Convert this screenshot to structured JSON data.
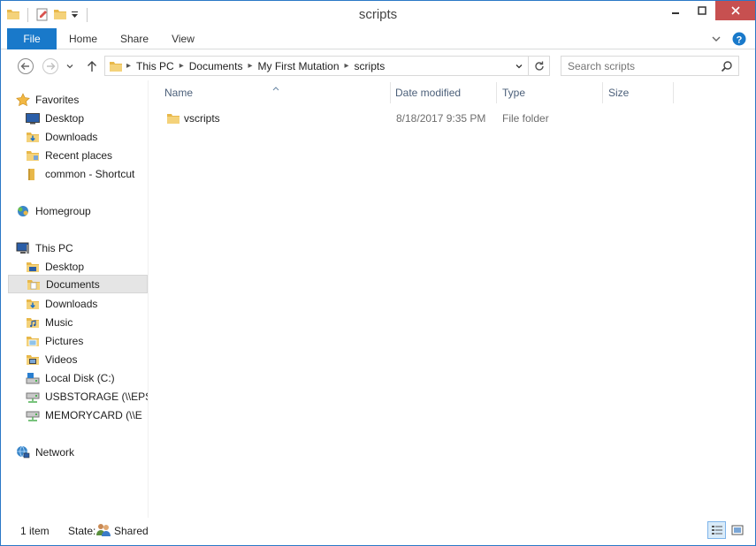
{
  "window": {
    "title": "scripts"
  },
  "ribbon": {
    "tabs": [
      "File",
      "Home",
      "Share",
      "View"
    ]
  },
  "address": {
    "crumbs": [
      "This PC",
      "Documents",
      "My First Mutation",
      "scripts"
    ]
  },
  "search": {
    "placeholder": "Search scripts"
  },
  "nav": {
    "favorites": {
      "label": "Favorites",
      "items": [
        "Desktop",
        "Downloads",
        "Recent places",
        "common - Shortcut"
      ]
    },
    "homegroup": {
      "label": "Homegroup"
    },
    "thispc": {
      "label": "This PC",
      "items": [
        "Desktop",
        "Documents",
        "Downloads",
        "Music",
        "Pictures",
        "Videos",
        "Local Disk (C:)",
        "USBSTORAGE (\\\\EPS",
        "MEMORYCARD (\\\\E"
      ]
    },
    "network": {
      "label": "Network"
    },
    "selected": "Documents"
  },
  "columns": {
    "name": "Name",
    "date": "Date modified",
    "type": "Type",
    "size": "Size"
  },
  "files": [
    {
      "name": "vscripts",
      "date": "8/18/2017 9:35 PM",
      "type": "File folder",
      "size": ""
    }
  ],
  "status": {
    "count": "1 item",
    "state_label": "State:",
    "state_value": "Shared"
  },
  "colors": {
    "accent": "#1979ca",
    "close": "#c75050",
    "folder": "#e8b84a",
    "header_text": "#4c607a"
  }
}
